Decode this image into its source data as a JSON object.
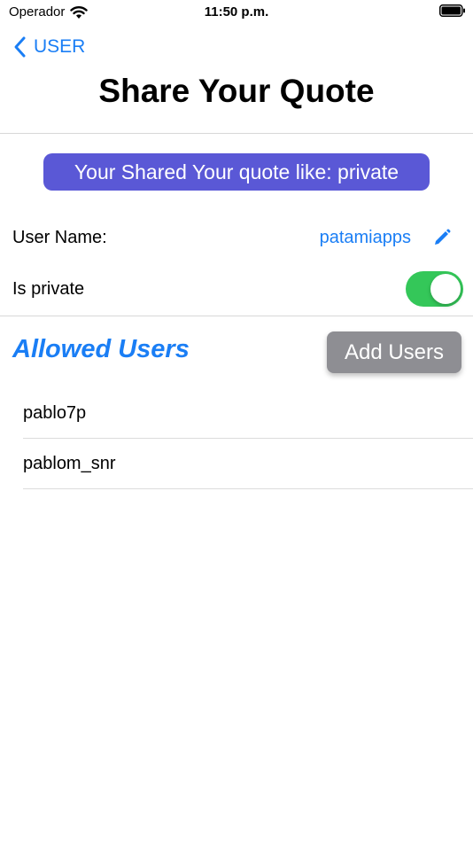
{
  "status_bar": {
    "carrier": "Operador",
    "time": "11:50 p.m.",
    "icons": [
      "wifi-icon",
      "battery-icon"
    ]
  },
  "nav": {
    "back_label": "USER",
    "back_icon": "chevron-left-icon",
    "title": "Share Your Quote"
  },
  "banner": {
    "text": "Your Shared Your quote like: private",
    "color": "#5a58d6"
  },
  "form": {
    "username_label": "User Name:",
    "username_value": "patamiapps",
    "edit_icon": "pencil-icon",
    "private_label": "Is private",
    "is_private": true
  },
  "allowed_users": {
    "title": "Allowed Users",
    "add_button_label": "Add Users",
    "users": [
      "pablo7p",
      "pablom_snr"
    ]
  },
  "colors": {
    "accent": "#1a7ef5",
    "toggle_on": "#34c759",
    "button_gray": "#8e8e93"
  }
}
